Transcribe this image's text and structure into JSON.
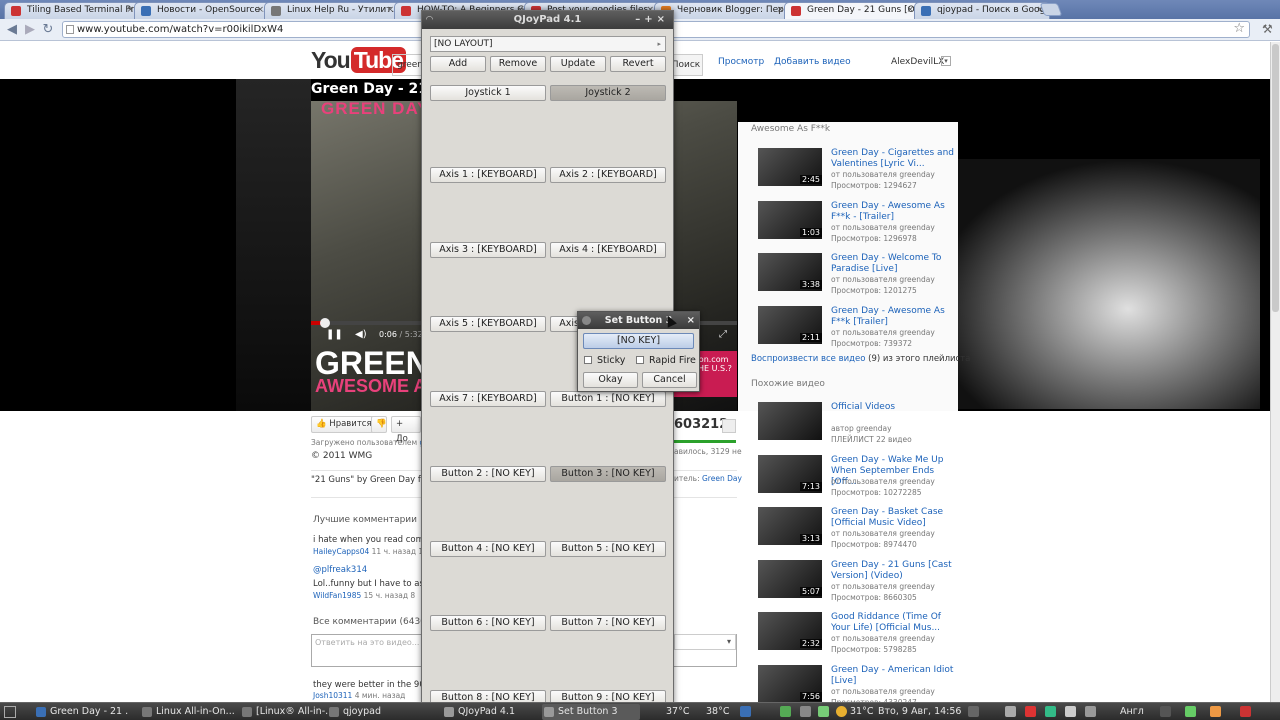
{
  "browser": {
    "tabs": [
      {
        "label": "Tiling Based Terminal Pr...",
        "icon_color": "#c33"
      },
      {
        "label": "Новости - OpenSource ...",
        "icon_color": "#3a6fb5"
      },
      {
        "label": "Linux Help Ru - Утилит...",
        "icon_color": "#777"
      },
      {
        "label": "HOW-TO: A Beginners G...",
        "icon_color": "#c33"
      },
      {
        "label": "Post your goodies files...",
        "icon_color": "#c33"
      },
      {
        "label": "Черновик Blogger: Пер...",
        "icon_color": "#e67e22"
      },
      {
        "label": "Green Day - 21 Guns [O...",
        "icon_color": "#c33"
      },
      {
        "label": "qjoypad - Поиск в Google",
        "icon_color": "#3a6fb5"
      }
    ],
    "url": "www.youtube.com/watch?v=r00ikilDxW4"
  },
  "youtube": {
    "logo_you": "You",
    "logo_tube": "Tube",
    "search_value": "green d",
    "search_button": "Поиск",
    "nav_browse": "Просмотр",
    "nav_upload": "Добавить видео",
    "username": "AlexDevilLX",
    "video_title": "Green Day - 21 G",
    "video_logo": "GREEN DAY",
    "video_time": "0:06",
    "video_duration": "/ 5:32",
    "video_banner_top": "GREEN",
    "video_banner_bottom": "AWESOME AS",
    "amazon_text": "amazon.com",
    "amazon_sub": "IDE THE U.S.?",
    "playlist_title": "Awesome As F**k",
    "playlist": [
      {
        "title": "Green Day - Cigarettes and Valentines [Lyric Vi...",
        "by": "от пользователя greenday",
        "views": "Просмотров: 1294627",
        "duration": "2:45"
      },
      {
        "title": "Green Day - Awesome As F**k - [Trailer]",
        "by": "от пользователя greenday",
        "views": "Просмотров: 1296978",
        "duration": "1:03"
      },
      {
        "title": "Green Day - Welcome To Paradise [Live]",
        "by": "от пользователя greenday",
        "views": "Просмотров: 1201275",
        "duration": "3:38"
      },
      {
        "title": "Green Day - Awesome As F**k [Trailer]",
        "by": "от пользователя greenday",
        "views": "Просмотров: 739372",
        "duration": "2:11"
      }
    ],
    "play_all_link": "Воспроизвести все видео",
    "play_all_rest": "(9) из этого плейлиста",
    "similar_title": "Похожие видео",
    "similar": [
      {
        "title": "Official Videos",
        "by": "автор greenday",
        "views": "ПЛЕЙЛИСТ 22 видео",
        "duration": ""
      },
      {
        "title": "Green Day - Wake Me Up When September Ends [Off...",
        "by": "от пользователя greenday",
        "views": "Просмотров: 10272285",
        "duration": "7:13"
      },
      {
        "title": "Green Day - Basket Case [Official Music Video]",
        "by": "от пользователя greenday",
        "views": "Просмотров: 8974470",
        "duration": "3:13"
      },
      {
        "title": "Green Day - 21 Guns [Cast Version] (Video)",
        "by": "от пользователя greenday",
        "views": "Просмотров: 8660305",
        "duration": "5:07"
      },
      {
        "title": "Good Riddance (Time Of Your Life) [Official Mus...",
        "by": "от пользователя greenday",
        "views": "Просмотров: 5798285",
        "duration": "2:32"
      },
      {
        "title": "Green Day - American Idiot [Live]",
        "by": "от пользователя greenday",
        "views": "Просмотров: 4330247",
        "duration": "7:56"
      }
    ],
    "like_button": "Нравится",
    "add_button": "+ До",
    "views_count": "603212",
    "likes_text": "авилось, 3129 не",
    "uploader_label": "Загружено пользователем",
    "uploader_name": "green",
    "copyright": "© 2011 WMG",
    "description": "\"21 Guns\" by Green Day from",
    "performer_label": "итель:",
    "performer_name": "Green Day",
    "best_comments_title": "Лучшие комментарии",
    "comments": [
      {
        "text": "i hate when you read comme",
        "user": "HaileyCapps04",
        "meta": "11 ч. назад 15"
      },
      {
        "text": "@plfreak314",
        "user": "",
        "meta": ""
      },
      {
        "text": "Lol..funny but I have to ask ho",
        "user": "WildFan1985",
        "meta": "15 ч. назад 8"
      }
    ],
    "all_comments_title": "Все комментарии (64369)",
    "comment_placeholder": "Ответить на это видео...",
    "last_comment": "they were better in the 90's",
    "last_comment_user": "Josh10311",
    "last_comment_meta": "4 мин. назад"
  },
  "qjoypad": {
    "title": "QJoyPad 4.1",
    "layout": "[NO LAYOUT]",
    "buttons": [
      "Add",
      "Remove",
      "Update",
      "Revert"
    ],
    "joysticks": [
      "Joystick 1",
      "Joystick 2"
    ],
    "mappings": [
      "Axis 1 : [KEYBOARD]",
      "Axis 2 : [KEYBOARD]",
      "Axis 3 : [KEYBOARD]",
      "Axis 4 : [KEYBOARD]",
      "Axis 5 : [KEYBOARD]",
      "Axis 6 : [KEYBOARD]",
      "Axis 7 : [KEYBOARD]",
      "Button 1 : [NO KEY]",
      "Button 2 : [NO KEY]",
      "Button 3 : [NO KEY]",
      "Button 4 : [NO KEY]",
      "Button 5 : [NO KEY]",
      "Button 6 : [NO KEY]",
      "Button 7 : [NO KEY]",
      "Button 8 : [NO KEY]",
      "Button 9 : [NO KEY]"
    ],
    "dialog": {
      "title": "Set Button 3",
      "key": "[NO KEY]",
      "sticky": "Sticky",
      "rapid_fire": "Rapid Fire",
      "okay": "Okay",
      "cancel": "Cancel"
    }
  },
  "taskbar": {
    "tasks": [
      {
        "label": "Green Day - 21 ...",
        "icon_color": "#3a6fb5"
      },
      {
        "label": "Linux All-in-On...",
        "icon_color": "#777"
      },
      {
        "label": "[Linux® All-in-...",
        "icon_color": "#777"
      },
      {
        "label": "qjoypad",
        "icon_color": "#777"
      },
      {
        "label": "QJoyPad 4.1",
        "icon_color": "#999"
      },
      {
        "label": "Set Button 3",
        "icon_color": "#999"
      }
    ],
    "temp1": "37°C",
    "temp2": "38°C",
    "weather": "31°C",
    "datetime": "Вто, 9 Авг, 14:56",
    "keyboard": "Англ"
  }
}
